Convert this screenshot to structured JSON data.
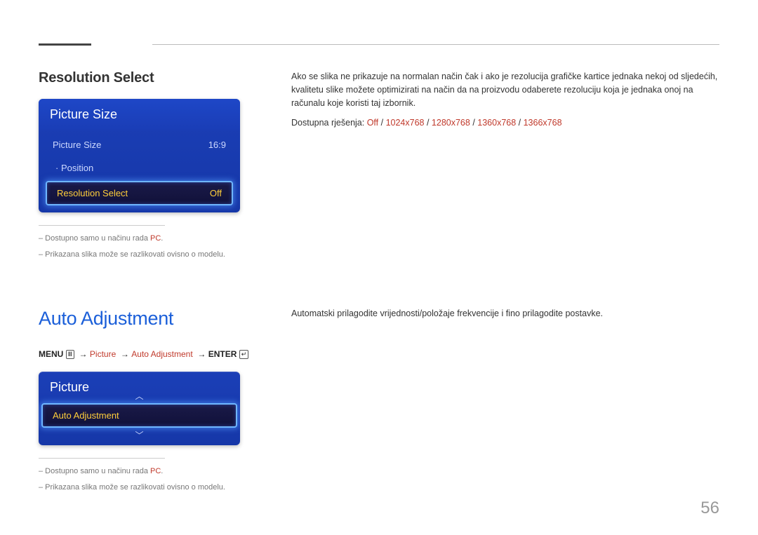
{
  "section1": {
    "title": "Resolution Select",
    "panel": {
      "header": "Picture Size",
      "row1": {
        "label": "Picture Size",
        "value": "16:9"
      },
      "row2": {
        "label": "· Position"
      },
      "selected": {
        "label": "Resolution Select",
        "value": "Off"
      }
    },
    "notes": {
      "n1_pre": "– Dostupno samo u načinu rada ",
      "n1_red": "PC",
      "n1_post": ".",
      "n2": "– Prikazana slika može se razlikovati ovisno o modelu."
    },
    "desc": "Ako se slika ne prikazuje na normalan način čak i ako je rezolucija grafičke kartice jednaka nekoj od sljedećih, kvalitetu slike možete optimizirati na način da na proizvodu odaberete rezoluciju koja je jednaka onoj na računalu koje koristi taj izbornik.",
    "opts": {
      "pre": "Dostupna rješenja: ",
      "o1": "Off",
      "o2": "1024x768",
      "o3": "1280x768",
      "o4": "1360x768",
      "o5": "1366x768",
      "sep": " / "
    }
  },
  "section2": {
    "title": "Auto Adjustment",
    "breadcrumb": {
      "menu": "MENU ",
      "p1": "Picture",
      "p2": "Auto Adjustment",
      "enter": "ENTER "
    },
    "panel": {
      "header": "Picture",
      "item": "Auto Adjustment"
    },
    "notes": {
      "n1_pre": "– Dostupno samo u načinu rada ",
      "n1_red": "PC",
      "n1_post": ".",
      "n2": "– Prikazana slika može se razlikovati ovisno o modelu."
    },
    "desc": "Automatski prilagodite vrijednosti/položaje frekvencije i fino prilagodite postavke."
  },
  "page": "56"
}
